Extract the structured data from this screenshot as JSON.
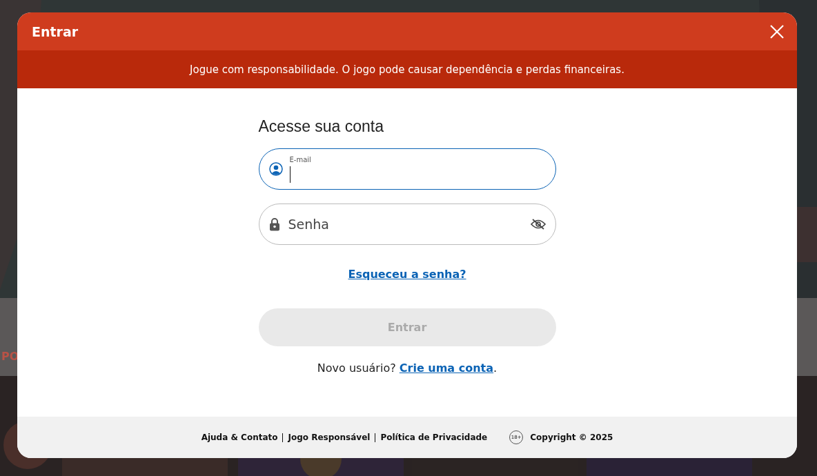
{
  "background": {
    "band_text": "PO"
  },
  "dialog": {
    "title": "Entrar",
    "warning": "Jogue com responsabilidade. O jogo pode causar dependência e perdas financeiras.",
    "heading": "Acesse sua conta",
    "fields": [
      {
        "kind": "email",
        "label": "E-mail",
        "focused": true
      },
      {
        "kind": "password",
        "placeholder": "Senha",
        "focused": false,
        "password_visible": false
      }
    ],
    "forgot_link": "Esqueceu a senha?",
    "submit": {
      "label": "Entrar",
      "disabled": true
    },
    "signup_prompt": "Novo usuário?",
    "signup_link": "Crie uma conta",
    "signup_end": ".",
    "footer_links": [
      "Ajuda & Contato",
      "Jogo Responsável",
      "Política de Privacidade"
    ],
    "age_badge": "18+",
    "copyright": "Copyright © 2025"
  }
}
